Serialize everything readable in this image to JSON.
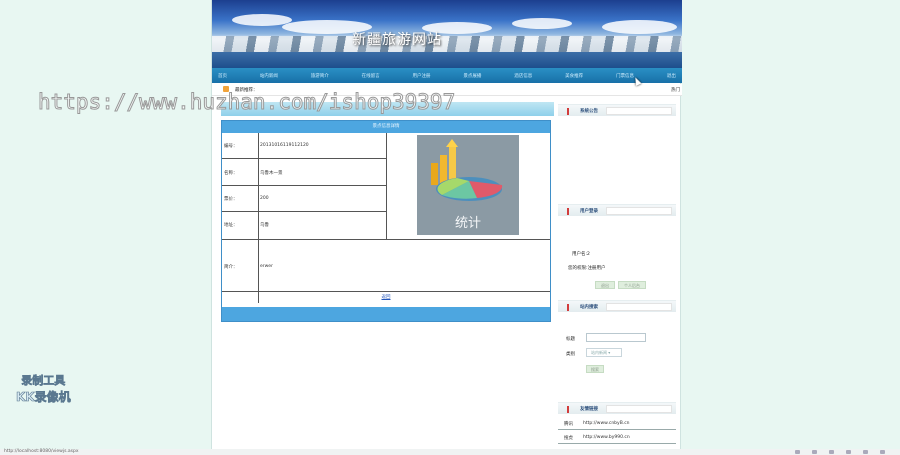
{
  "site": {
    "title": "新疆旅游网站"
  },
  "nav": {
    "items": [
      "首页",
      "站内新闻",
      "旅游简介",
      "在线留言",
      "用户注册",
      "景点展播",
      "酒店信息",
      "美食推荐",
      "门票信息",
      "退出"
    ]
  },
  "news": {
    "label": "最新推荐：",
    "more": "热门"
  },
  "watermark": "https://www.huzhan.com/ishop39397",
  "detail": {
    "header": "景点信息详情",
    "fields": [
      {
        "label": "编号：",
        "value": "20131016119112120"
      },
      {
        "label": "名称：",
        "value": "乌鲁木一景"
      },
      {
        "label": "票价：",
        "value": "200"
      },
      {
        "label": "地址：",
        "value": "乌鲁"
      }
    ],
    "intro_label": "简介：",
    "intro_value": "erwer",
    "image_text": "统计",
    "back_link": "返回"
  },
  "sidebar": {
    "announcement": {
      "title": "系统公告"
    },
    "user": {
      "title": "用户登录",
      "username_line": "用户名:2",
      "role_line": "您的权限:注册用户",
      "logout_label": "退出",
      "profile_label": "个人后台"
    },
    "search": {
      "title": "站内搜索",
      "title_label": "标题",
      "category_label": "类别",
      "category_value": "站内新闻",
      "search_label": "搜索"
    },
    "links": {
      "title": "友情链接",
      "items": [
        {
          "name": "腾讯",
          "url": "http://www.cnbyB.cn"
        },
        {
          "name": "搜虎",
          "url": "http://www.by990.cn"
        }
      ]
    }
  },
  "recorder": {
    "line1": "录制工具",
    "line2": "KK录像机"
  },
  "status": {
    "url": "http://localhost:8080/viewjs.aspx"
  }
}
